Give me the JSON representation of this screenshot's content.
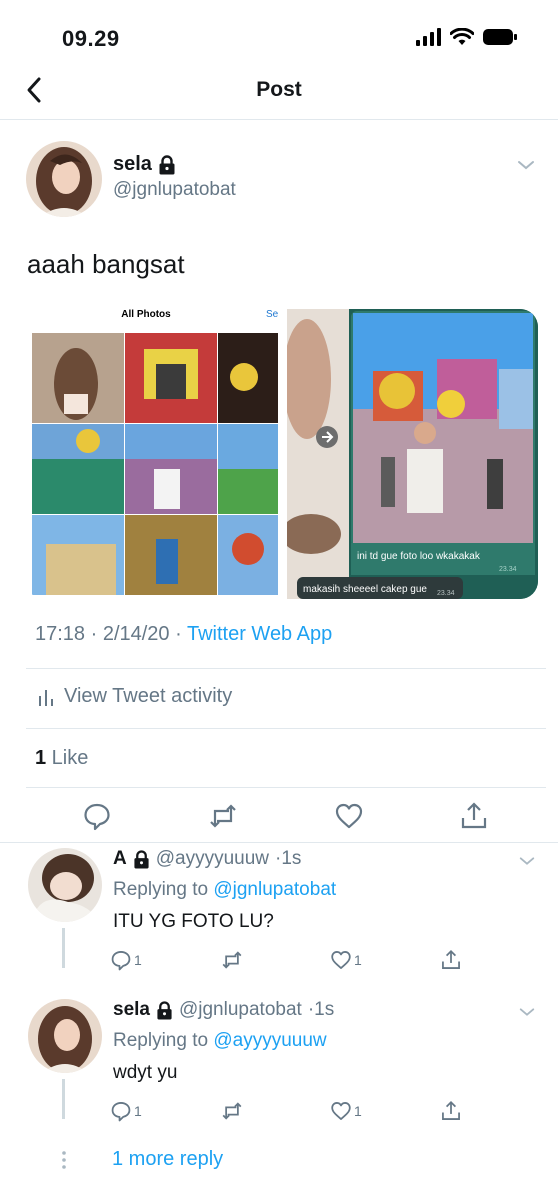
{
  "status_bar": {
    "time": "09.29"
  },
  "nav": {
    "title": "Post"
  },
  "tweet": {
    "author_name": "sela",
    "author_handle": "@jgnlupatobat",
    "text": "aaah bangsat",
    "media": {
      "left_header": "All Photos",
      "left_header_right": "Se",
      "chat_bubble_1": "ini td gue foto loo wkakakak",
      "chat_bubble_1_time": "23.34",
      "chat_bubble_2": "makasih sheeeel cakep gue",
      "chat_bubble_2_time": "23.34"
    },
    "meta_time": "17:18 · 2/14/20 · ",
    "meta_client": "Twitter Web App",
    "activity_label": "View Tweet activity",
    "likes_count": "1",
    "likes_label": " Like"
  },
  "replies": [
    {
      "name": "A",
      "handle": "@ayyyyuuuw",
      "time": "·1s",
      "replying_label": "Replying to ",
      "replying_to": "@jgnlupatobat",
      "text": "ITU YG FOTO LU?",
      "reply_count": "1",
      "like_count": "1"
    },
    {
      "name": "sela",
      "handle": "@jgnlupatobat",
      "time": "·1s",
      "replying_label": "Replying to ",
      "replying_to": "@ayyyyuuuw",
      "text": "wdyt yu",
      "reply_count": "1",
      "like_count": "1"
    }
  ],
  "more_reply": "1 more reply",
  "colors": {
    "accent": "#1da1f2",
    "muted": "#657786",
    "text": "#14171a",
    "border": "#e1e8ed"
  }
}
